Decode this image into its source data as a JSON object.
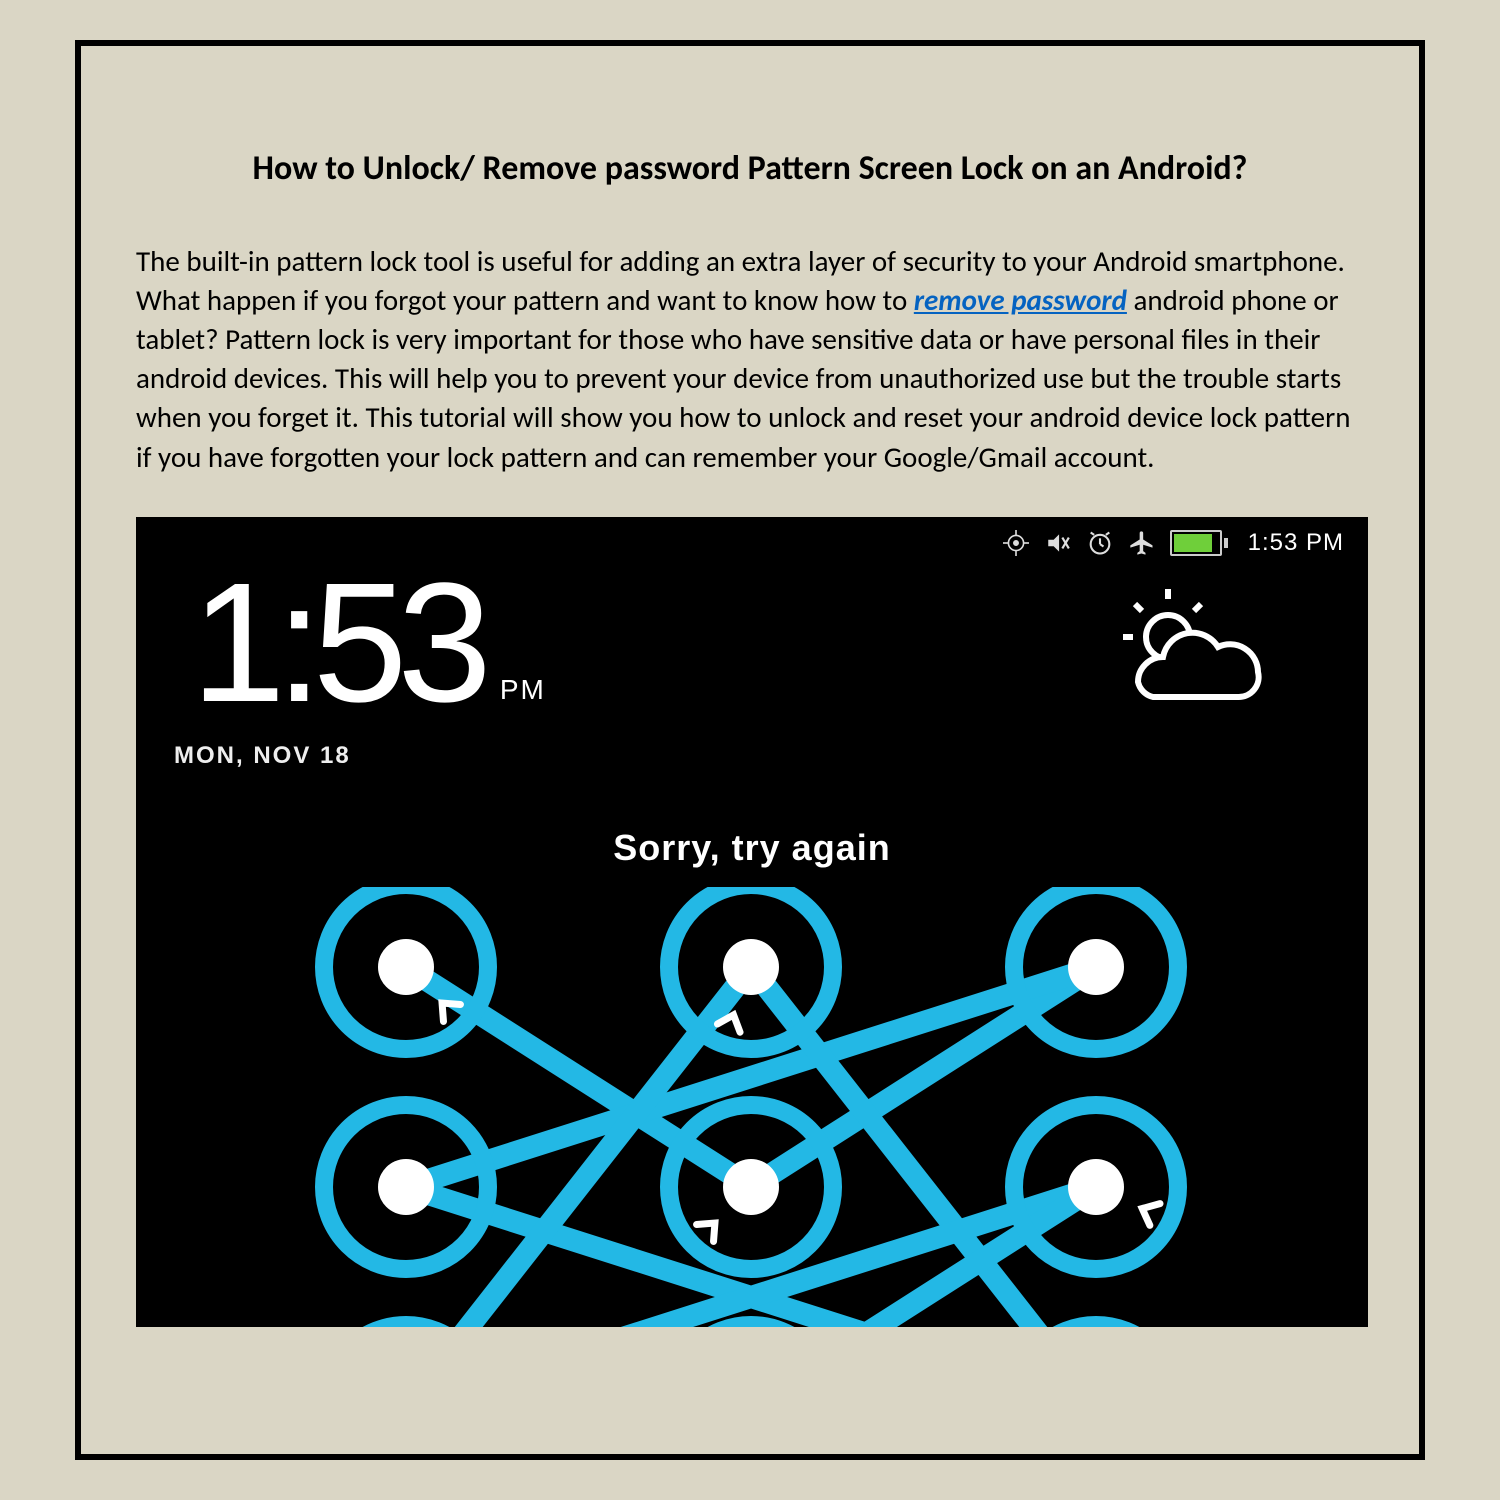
{
  "title": "How to Unlock/ Remove password Pattern Screen Lock on an Android?",
  "paragraph": {
    "pre": "The built-in pattern lock tool is useful for adding an extra layer of security to your Android smartphone. What happen if you forgot your pattern and want to know how to ",
    "link": "remove password",
    "post": " android phone or tablet? Pattern lock is very important for those who have sensitive data or have personal files in their android devices. This will help you to prevent your device from unauthorized use but the trouble starts when you forget it. This tutorial will show you how to unlock and reset your android device lock pattern if you have forgotten your lock pattern and can remember your Google/Gmail account."
  },
  "phone": {
    "status_time": "1:53 PM",
    "clock_hour": "1",
    "clock_min": ":53",
    "clock_pm": "PM",
    "date": "MON, NOV 18",
    "error": "Sorry, try again"
  }
}
